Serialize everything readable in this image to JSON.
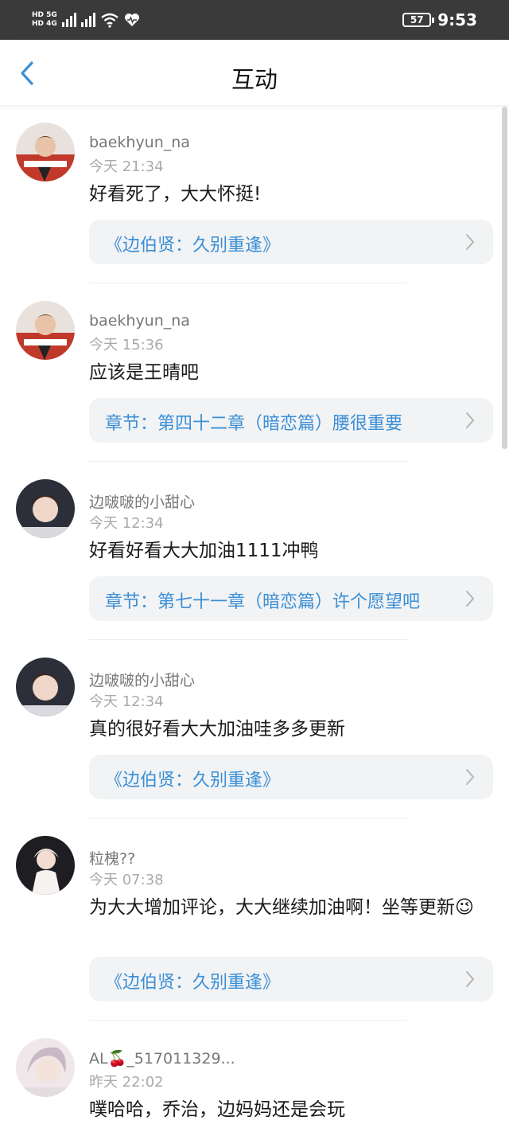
{
  "status_bar": {
    "net_top": "HD 5G",
    "net_bottom": "HD 4G",
    "battery": "57",
    "time": "9:53"
  },
  "header": {
    "title": "互动"
  },
  "comments": [
    {
      "username": "baekhyun_na",
      "time": "今天 21:34",
      "content": "好看死了，大大怀挺!",
      "ref": "《边伯贤：久别重逢》"
    },
    {
      "username": "baekhyun_na",
      "time": "今天 15:36",
      "content": "应该是王晴吧",
      "ref": "章节：第四十二章（暗恋篇）腰很重要"
    },
    {
      "username": "边啵啵的小甜心",
      "time": "今天 12:34",
      "content": "好看好看大大加油1111冲鸭",
      "ref": "章节：第七十一章（暗恋篇）许个愿望吧"
    },
    {
      "username": "边啵啵的小甜心",
      "time": "今天 12:34",
      "content": "真的很好看大大加油哇多多更新",
      "ref": "《边伯贤：久别重逢》"
    },
    {
      "username": "粒槐??",
      "time": "今天 07:38",
      "content": "为大大增加评论，大大继续加油啊！坐等更新😉",
      "ref": "《边伯贤：久别重逢》"
    },
    {
      "username": "AL🍒_517011329...",
      "time": "昨天 22:02",
      "content": "噗哈哈，乔治，边妈妈还是会玩",
      "ref": ""
    }
  ],
  "colors": {
    "accent": "#3a8fd6",
    "status_bar_bg": "#3a3a3a"
  },
  "icons": {
    "back": "chevron-left-icon",
    "ref_arrow": "chevron-right-icon"
  }
}
